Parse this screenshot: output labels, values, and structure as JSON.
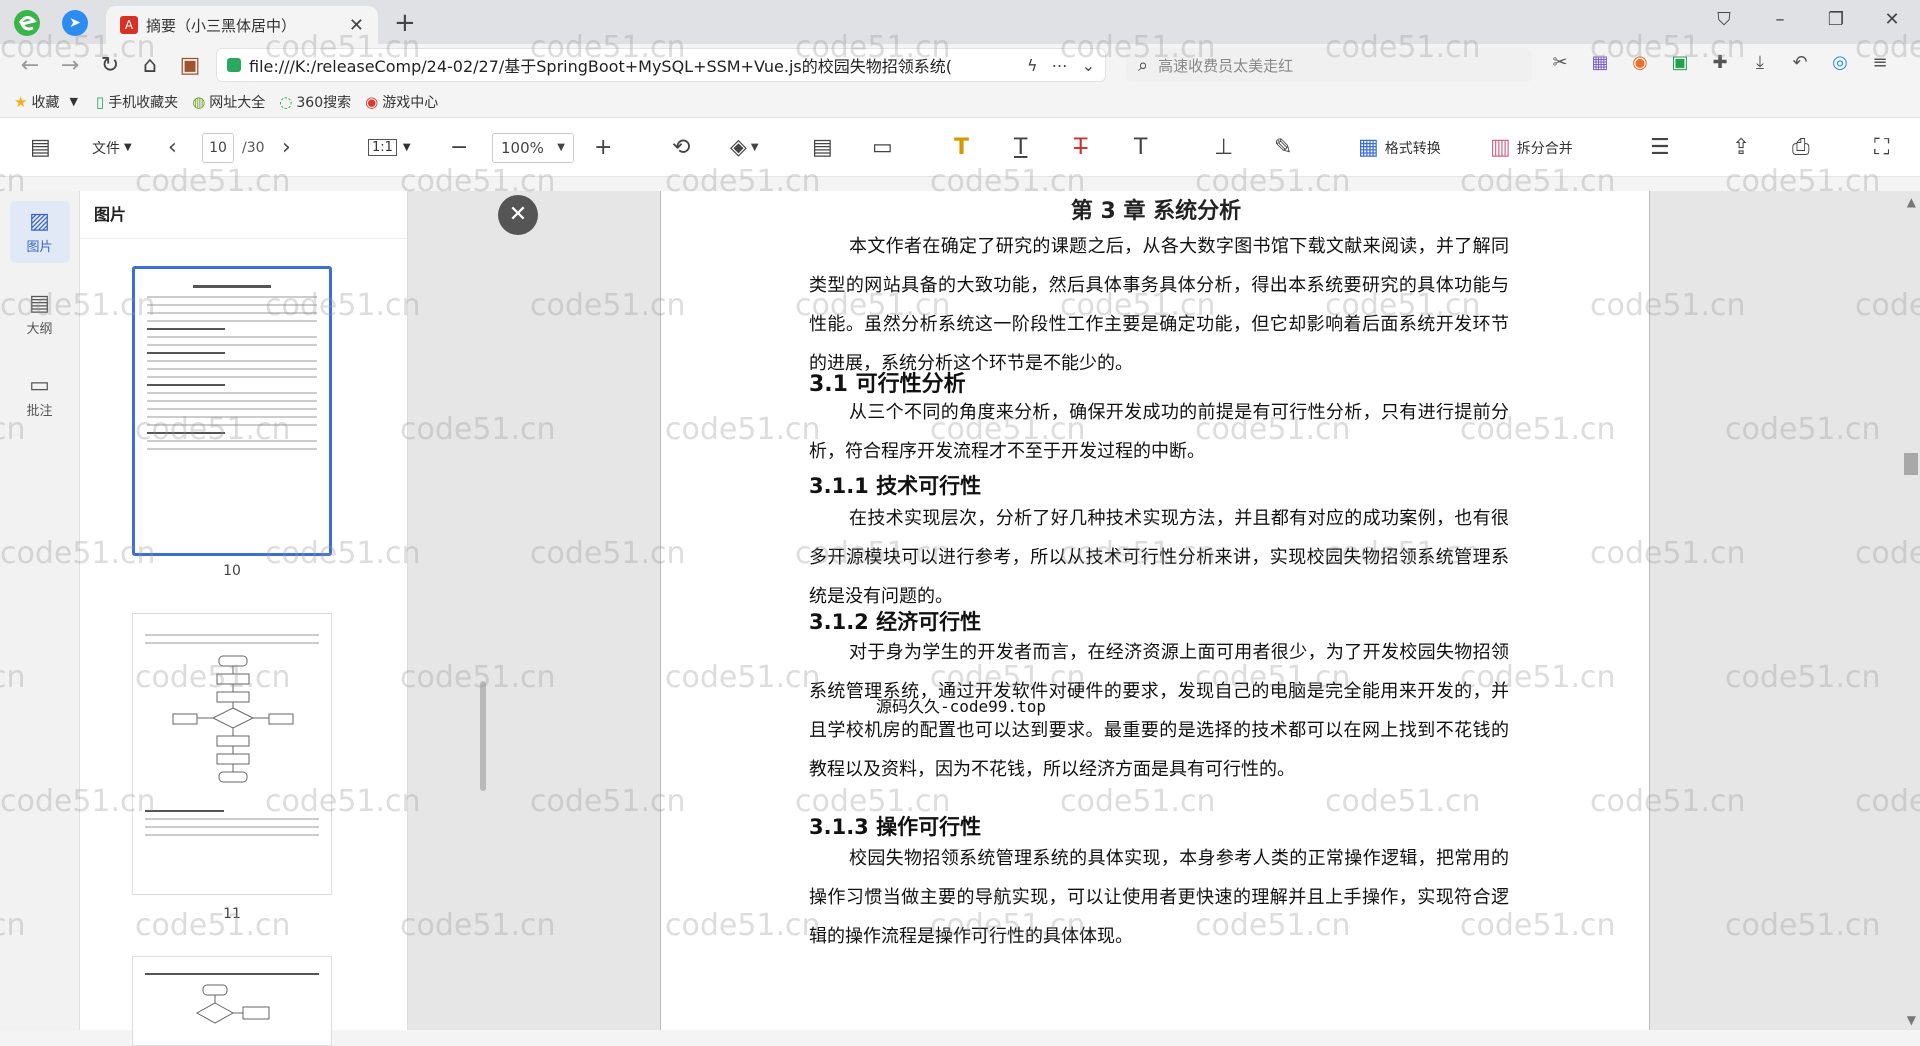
{
  "browser": {
    "tab_title": "摘要（小三黑体居中）",
    "url": "file:///K:/releaseComp/24-02/27/基于SpringBoot+MySQL+SSM+Vue.js的校园失物招领系统(",
    "search_placeholder": "高速收费员太美走红",
    "bookmarks": [
      {
        "icon": "star-icon",
        "label": "收藏"
      },
      {
        "icon": "phone-icon",
        "label": "手机收藏夹"
      },
      {
        "icon": "globe-icon",
        "label": "网址大全"
      },
      {
        "icon": "search360-icon",
        "label": "360搜索"
      },
      {
        "icon": "game-icon",
        "label": "游戏中心"
      }
    ]
  },
  "toolbar": {
    "file_label": "文件",
    "current_page": "10",
    "total_pages": "/30",
    "fit_label": "1:1",
    "zoom": "100%",
    "convert_label": "格式转换",
    "split_merge_label": "拆分合并"
  },
  "sidebar": {
    "rail": [
      {
        "label": "图片",
        "icon": "image-icon"
      },
      {
        "label": "大纲",
        "icon": "outline-icon"
      },
      {
        "label": "批注",
        "icon": "comment-icon"
      }
    ],
    "panel_title": "图片",
    "thumbnails": [
      {
        "number": "10"
      },
      {
        "number": "11"
      }
    ]
  },
  "document": {
    "chapter_title": "第 3 章  系统分析",
    "intro": "本文作者在确定了研究的课题之后，从各大数字图书馆下载文献来阅读，并了解同类型的网站具备的大致功能，然后具体事务具体分析，得出本系统要研究的具体功能与性能。虽然分析系统这一阶段性工作主要是确定功能，但它却影响着后面系统开发环节的进展，系统分析这个环节是不能少的。",
    "s31_title": "3.1  可行性分析",
    "s31_body": "从三个不同的角度来分析，确保开发成功的前提是有可行性分析，只有进行提前分析，符合程序开发流程才不至于开发过程的中断。",
    "stamp": "源码久久-code99.top",
    "s311_title": "3.1.1  技术可行性",
    "s311_body": "在技术实现层次，分析了好几种技术实现方法，并且都有对应的成功案例，也有很多开源模块可以进行参考，所以从技术可行性分析来讲，实现校园失物招领系统管理系统是没有问题的。",
    "s312_title": "3.1.2  经济可行性",
    "s312_body": "对于身为学生的开发者而言，在经济资源上面可用者很少，为了开发校园失物招领系统管理系统，通过开发软件对硬件的要求，发现自己的电脑是完全能用来开发的，并且学校机房的配置也可以达到要求。最重要的是选择的技术都可以在网上找到不花钱的教程以及资料，因为不花钱，所以经济方面是具有可行性的。",
    "s313_title": "3.1.3  操作可行性",
    "s313_body": "校园失物招领系统管理系统的具体实现，本身参考人类的正常操作逻辑，把常用的操作习惯当做主要的导航实现，可以让使用者更快速的理解并且上手操作，实现符合逻辑的操作流程是操作可行性的具体体现。"
  },
  "watermark": "code51.cn"
}
